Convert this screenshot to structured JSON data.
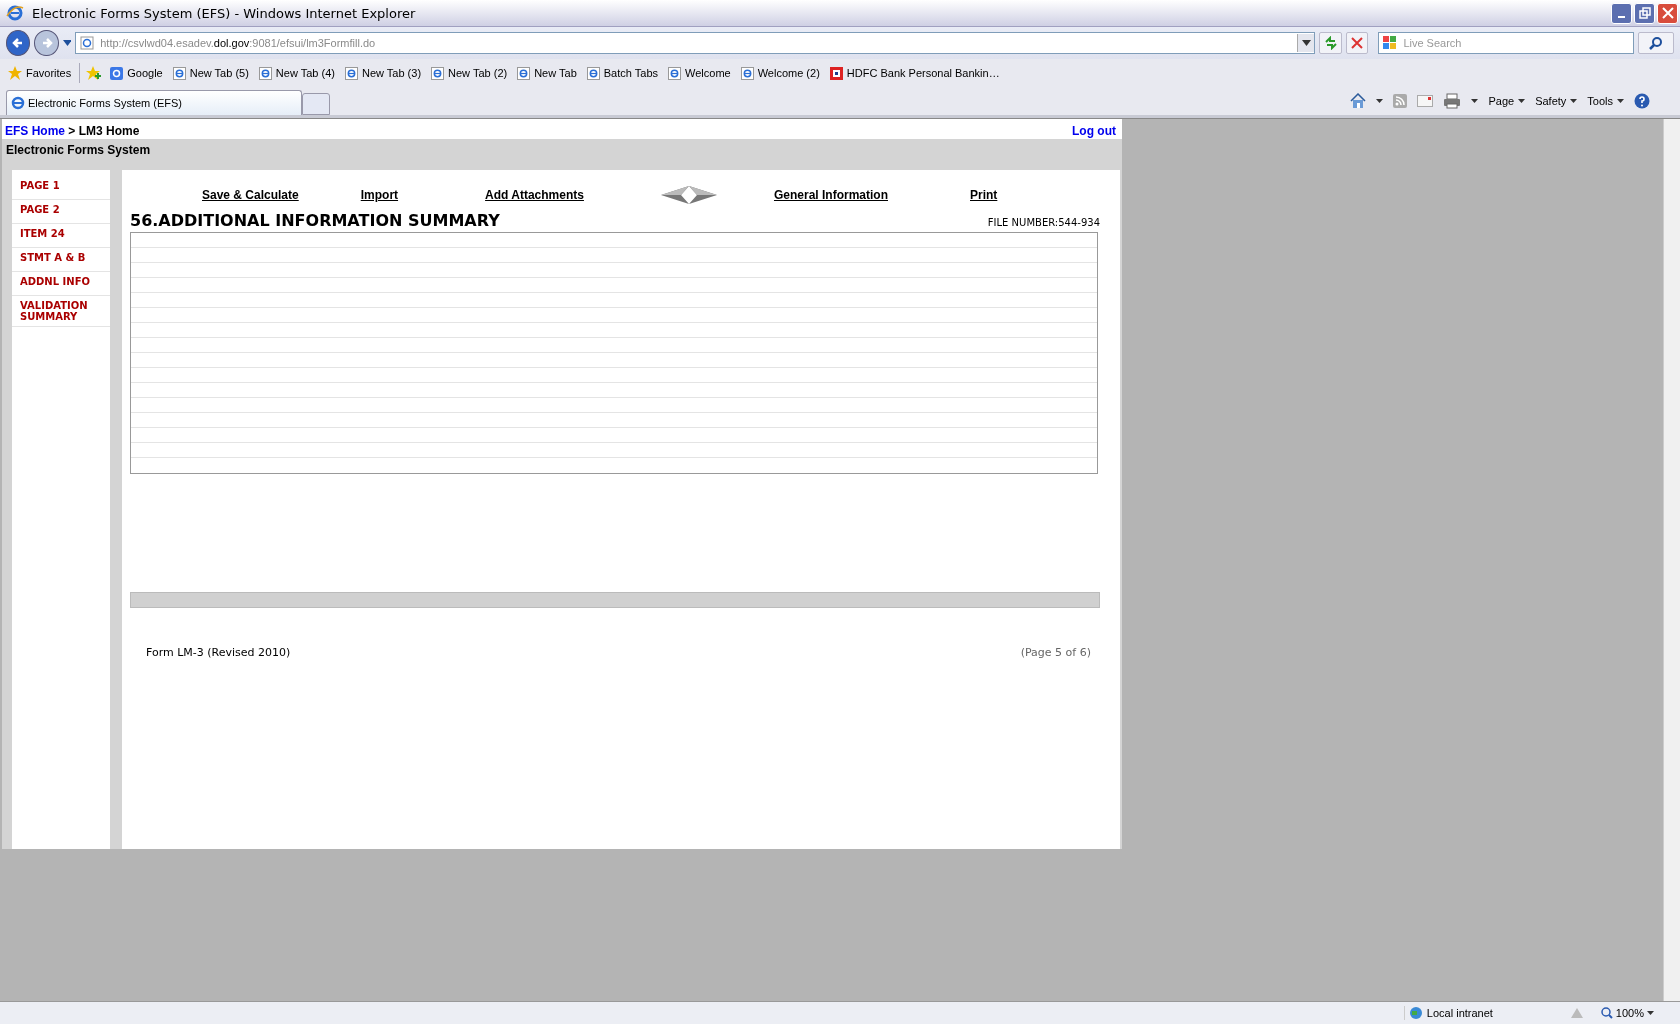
{
  "window": {
    "title": "Electronic Forms System (EFS) - Windows Internet Explorer"
  },
  "address": {
    "prefix": "http://csvlwd04.esadev.",
    "domain": "dol.gov",
    "suffix": ":9081/efsui/lm3Formfill.do"
  },
  "search": {
    "placeholder": "Live Search"
  },
  "favorites": {
    "label": "Favorites",
    "items": [
      {
        "label": "Google",
        "kind": "google"
      },
      {
        "label": "New Tab (5)",
        "kind": "ie"
      },
      {
        "label": "New Tab (4)",
        "kind": "ie"
      },
      {
        "label": "New Tab (3)",
        "kind": "ie"
      },
      {
        "label": "New Tab (2)",
        "kind": "ie"
      },
      {
        "label": "New Tab",
        "kind": "ie"
      },
      {
        "label": "Batch Tabs",
        "kind": "ie"
      },
      {
        "label": "Welcome",
        "kind": "ie"
      },
      {
        "label": "Welcome (2)",
        "kind": "ie"
      },
      {
        "label": "HDFC Bank Personal Bankin…",
        "kind": "bank"
      }
    ]
  },
  "tabs": [
    {
      "label": "Electronic Forms System (EFS)",
      "selected": true
    }
  ],
  "command_bar": [
    "Page",
    "Safety",
    "Tools"
  ],
  "breadcrumb": {
    "home": "EFS Home",
    "separator": ">",
    "current": "LM3 Home"
  },
  "logout": "Log out",
  "app_title": "Electronic Forms System",
  "sidebar": {
    "items": [
      {
        "label": "PAGE 1"
      },
      {
        "label": "PAGE 2"
      },
      {
        "label": "ITEM 24"
      },
      {
        "label": "STMT A & B"
      },
      {
        "label": "ADDNL INFO"
      },
      {
        "label": "VALIDATION SUMMARY"
      }
    ]
  },
  "toolbar": [
    "Save & Calculate",
    "Import",
    "Add Attachments",
    "General Information",
    "Print"
  ],
  "heading": "56.ADDITIONAL INFORMATION SUMMARY",
  "file_number": "FILE NUMBER:544-934",
  "footer": {
    "form": "Form LM-3 (Revised 2010)",
    "page": "(Page 5 of 6)"
  },
  "status_bar": {
    "zone": "Local intranet",
    "zoom": "100%"
  }
}
